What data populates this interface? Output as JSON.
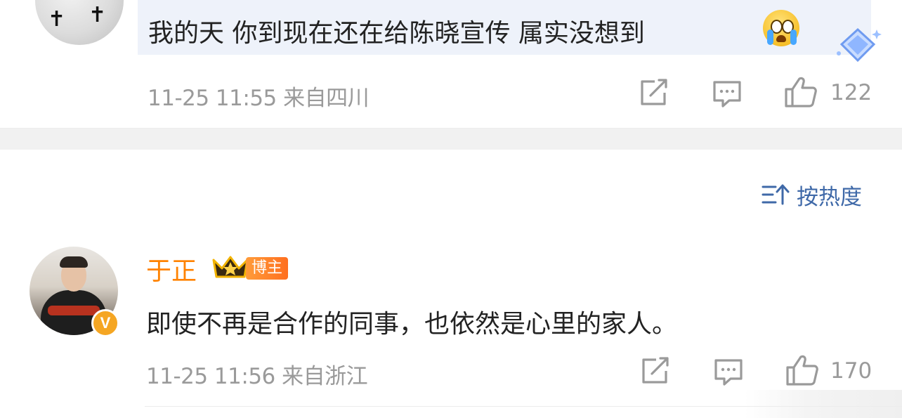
{
  "comments": [
    {
      "text": "我的天 你到现在还在给陈晓宣传 属实没想到",
      "emoji": "crying-face-emoji",
      "badge_icon": "blue-diamond-badge-icon",
      "time": "11-25 11:55",
      "location": "来自四川",
      "likes": "122"
    },
    {
      "username": "于正",
      "tag": "博主",
      "verified": "V",
      "text": "即使不再是合作的同事，也依然是心里的家人。",
      "time": "11-25 11:56",
      "location": "来自浙江",
      "likes": "170"
    }
  ],
  "sort": {
    "label": "按热度",
    "icon": "sort-icon"
  },
  "colors": {
    "username": "#ff8200",
    "sort_label": "#3f69a8",
    "meta": "#9a9a9a",
    "bubble": "#eef2fa",
    "divider": "#f1f1f1"
  }
}
